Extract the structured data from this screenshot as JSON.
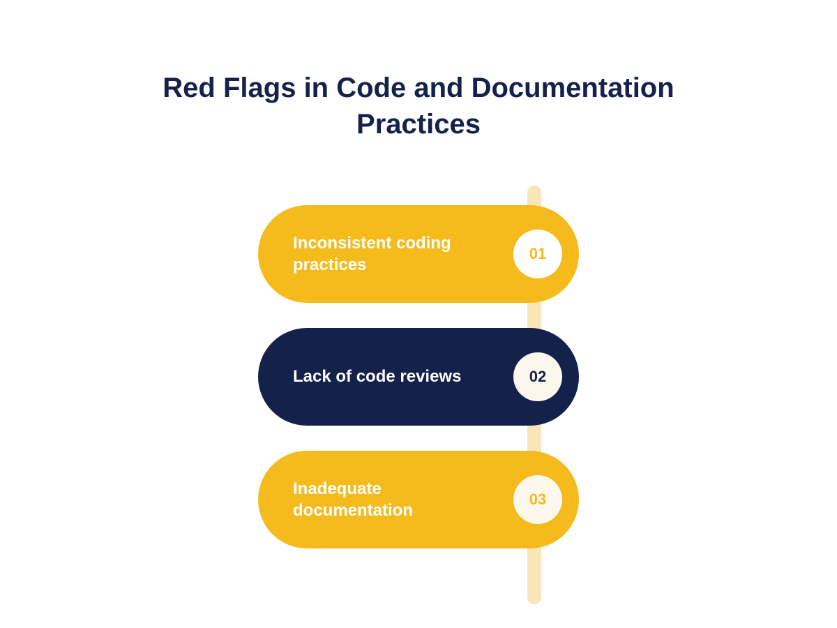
{
  "title": "Red Flags in Code and Documentation Practices",
  "items": [
    {
      "label": "Inconsistent coding practices",
      "number": "01"
    },
    {
      "label": "Lack of code reviews",
      "number": "02"
    },
    {
      "label": "Inadequate documentation",
      "number": "03"
    }
  ]
}
